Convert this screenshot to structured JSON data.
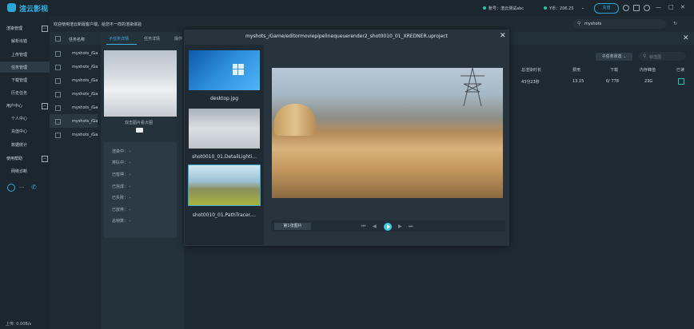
{
  "app": {
    "name": "渲云影视"
  },
  "topbar": {
    "account_label": "账号：渲云测试abc",
    "balance_label": "Y币：206.25",
    "recharge_label": "充值",
    "window_buttons": [
      "—",
      "□",
      "✕"
    ]
  },
  "subbar": {
    "notice": "欢迎使用渲云新版客户端，给您不一样的渲染体验",
    "search_value": "myshots"
  },
  "sidebar": {
    "sections": [
      {
        "label": "渲染管理",
        "toggle": "−",
        "items": [
          "解析出错",
          "上传管理",
          "任务管理",
          "下载管理",
          "历史任务"
        ]
      },
      {
        "label": "用户中心",
        "toggle": "−",
        "items": [
          "个人中心",
          "充值中心",
          "数据统计"
        ]
      },
      {
        "label": "使用帮助",
        "toggle": "−",
        "items": [
          "网络诊断"
        ]
      }
    ],
    "speed": "上传: 0.00B/s"
  },
  "task_list": {
    "header": "任务名称",
    "rows": [
      "myshots_/Ga",
      "myshots_/Ga",
      "myshots_/Ga",
      "myshots_/Ga",
      "myshots_/Ga",
      "myshots_/Ga",
      "myshots_/Ga",
      "myshots_/Ga"
    ]
  },
  "detail_panel": {
    "tabs": [
      "子任务详情",
      "任务详情",
      "操作"
    ],
    "dbl_click_label": "双击图片看大图",
    "stats": [
      "渲染中： -",
      "排队中： -",
      "已暂停： -",
      "已完成： -",
      "已失败： -",
      "已放弃： -",
      "总帧数： -"
    ]
  },
  "table": {
    "filter_label": "子任务状态",
    "filter_placeholder": "帧范围",
    "headers": [
      "总渲染时长",
      "费用",
      "下载",
      "内存峰值",
      "已读"
    ],
    "row": [
      "43分23秒",
      "13.15",
      "0/ 778",
      "23G",
      ""
    ]
  },
  "viewer": {
    "title": "myshots_/Game/editormoviepipelinequeuerender2_shot0010_01_XREDNER.uproject",
    "thumbnails": [
      "desktop.jpg",
      "shot0010_01.DetailLighti...",
      "shot0010_01.PathTracer...."
    ],
    "page_info": "第1张图片",
    "pager_icons": [
      "⏮",
      "◀",
      "▶",
      "⏭"
    ]
  }
}
